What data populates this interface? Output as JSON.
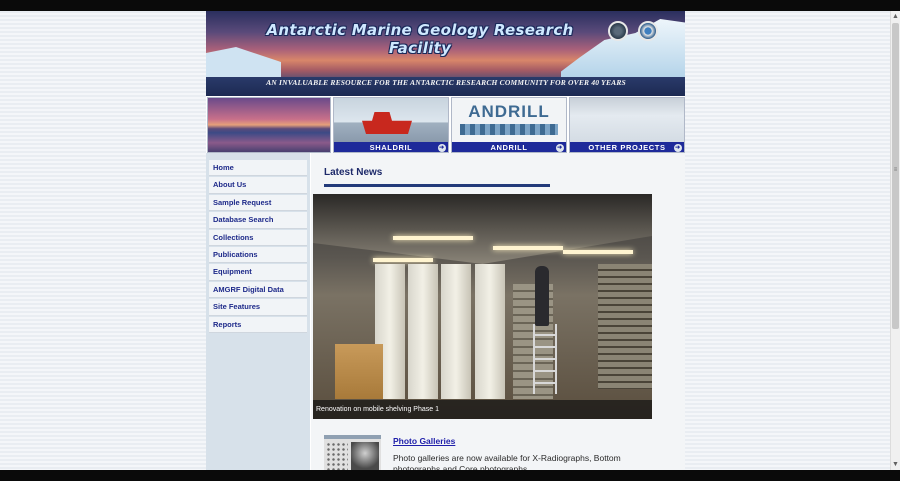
{
  "banner": {
    "title": "Antarctic Marine Geology Research Facility",
    "subtitle": "AN INVALUABLE RESOURCE FOR THE ANTARCTIC RESEARCH COMMUNITY FOR OVER 40 YEARS"
  },
  "tiles": [
    {
      "label": ""
    },
    {
      "label": "SHALDRIL"
    },
    {
      "label": "ANDRILL",
      "logo_text": "ANDRILL"
    },
    {
      "label": "OTHER PROJECTS"
    }
  ],
  "nav": {
    "items": [
      {
        "label": "Home"
      },
      {
        "label": "About Us"
      },
      {
        "label": "Sample Request"
      },
      {
        "label": "Database Search"
      },
      {
        "label": "Collections"
      },
      {
        "label": "Publications"
      },
      {
        "label": "Equipment"
      },
      {
        "label": "AMGRF Digital Data"
      },
      {
        "label": "Site Features"
      },
      {
        "label": "Reports"
      }
    ]
  },
  "news": {
    "title": "Latest News",
    "photo_caption": "Renovation on mobile shelving Phase 1",
    "gallery_link": "Photo Galleries",
    "gallery_text": "Photo galleries are now available for X-Radiographs, Bottom photographs and Core photographs."
  },
  "colors": {
    "nav_text": "#1e2a8a",
    "tile_label_bg": "#1e2a9a",
    "heading": "#1e2a6a",
    "link": "#1e1eaa"
  }
}
